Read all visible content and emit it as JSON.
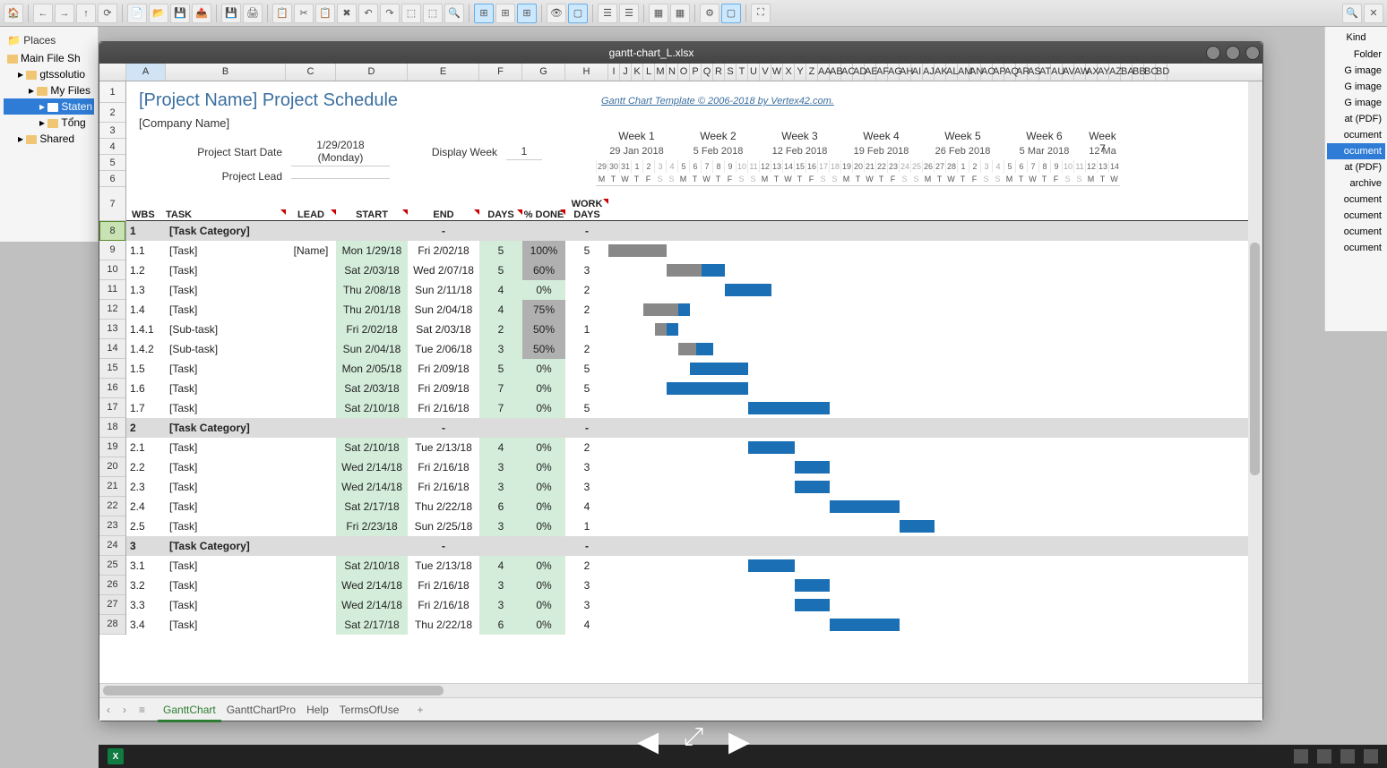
{
  "window_title": "gantt-chart_L.xlsx",
  "sidebar": {
    "places": "Places",
    "items": [
      {
        "label": "Main File Sh",
        "lvl": 1
      },
      {
        "label": "gtssolutio",
        "lvl": 2
      },
      {
        "label": "My Files",
        "lvl": 3
      },
      {
        "label": "Staten",
        "lvl": 4,
        "selected": true
      },
      {
        "label": "Tổng",
        "lvl": 4
      },
      {
        "label": "Shared",
        "lvl": 2
      }
    ]
  },
  "rightpanel": {
    "header": "Kind",
    "items": [
      {
        "t": "Folder"
      },
      {
        "t": "G image"
      },
      {
        "t": "G image"
      },
      {
        "t": "G image"
      },
      {
        "t": "at (PDF)"
      },
      {
        "t": "ocument"
      },
      {
        "t": "ocument",
        "sel": true
      },
      {
        "t": "at (PDF)"
      },
      {
        "t": "archive"
      },
      {
        "t": "ocument"
      },
      {
        "t": "ocument"
      },
      {
        "t": "ocument"
      },
      {
        "t": "ocument"
      }
    ]
  },
  "columns": [
    "A",
    "B",
    "C",
    "D",
    "E",
    "F",
    "G",
    "H",
    "I",
    "J",
    "K",
    "L",
    "M",
    "N",
    "O",
    "P",
    "Q",
    "R",
    "S",
    "T",
    "U",
    "V",
    "W",
    "X",
    "Y",
    "Z",
    "AA",
    "AB",
    "AC",
    "AD",
    "AE",
    "AF",
    "AG",
    "AH",
    "AI",
    "AJ",
    "AK",
    "AL",
    "AM",
    "AN",
    "AO",
    "AP",
    "AQ",
    "AR",
    "AS",
    "AT",
    "AU",
    "AV",
    "AW",
    "AX",
    "AY",
    "AZ",
    "BA",
    "BB",
    "BC",
    "BD"
  ],
  "header": {
    "title": "[Project Name] Project Schedule",
    "company": "[Company Name]",
    "credit": "Gantt Chart Template © 2006-2018 by Vertex42.com.",
    "start_label": "Project Start Date",
    "start_val": "1/29/2018 (Monday)",
    "display_label": "Display Week",
    "display_val": "1",
    "lead_label": "Project Lead"
  },
  "tblhdr": {
    "wbs": "WBS",
    "task": "TASK",
    "lead": "LEAD",
    "start": "START",
    "end": "END",
    "days": "DAYS",
    "done": "% DONE",
    "work": "WORK DAYS"
  },
  "weeks": [
    {
      "title": "Week 1",
      "date": "29 Jan 2018",
      "days": [
        "29",
        "30",
        "31",
        "1",
        "2",
        "3",
        "4"
      ]
    },
    {
      "title": "Week 2",
      "date": "5 Feb 2018",
      "days": [
        "5",
        "6",
        "7",
        "8",
        "9",
        "10",
        "11"
      ]
    },
    {
      "title": "Week 3",
      "date": "12 Feb 2018",
      "days": [
        "12",
        "13",
        "14",
        "15",
        "16",
        "17",
        "18"
      ]
    },
    {
      "title": "Week 4",
      "date": "19 Feb 2018",
      "days": [
        "19",
        "20",
        "21",
        "22",
        "23",
        "24",
        "25"
      ]
    },
    {
      "title": "Week 5",
      "date": "26 Feb 2018",
      "days": [
        "26",
        "27",
        "28",
        "1",
        "2",
        "3",
        "4"
      ]
    },
    {
      "title": "Week 6",
      "date": "5 Mar 2018",
      "days": [
        "5",
        "6",
        "7",
        "8",
        "9",
        "10",
        "11"
      ]
    },
    {
      "title": "Week 7",
      "date": "12 Ma",
      "days": [
        "12",
        "13",
        "14"
      ]
    }
  ],
  "dow": [
    "M",
    "T",
    "W",
    "T",
    "F",
    "S",
    "S"
  ],
  "rows": [
    {
      "n": 8,
      "cat": true,
      "wbs": "1",
      "task": "[Task Category]",
      "end": "-",
      "work": "-"
    },
    {
      "n": 9,
      "wbs": "1.1",
      "task": "[Task]",
      "lead": "[Name]",
      "start": "Mon 1/29/18",
      "end": "Fri 2/02/18",
      "days": "5",
      "done": "100%",
      "dcls": "pgrey",
      "work": "5",
      "bar": {
        "off": 0,
        "len": 5,
        "prog": 100
      }
    },
    {
      "n": 10,
      "wbs": "1.2",
      "task": "[Task]",
      "start": "Sat 2/03/18",
      "end": "Wed 2/07/18",
      "days": "5",
      "done": "60%",
      "dcls": "pgrey",
      "work": "3",
      "bar": {
        "off": 5,
        "len": 5,
        "prog": 60
      }
    },
    {
      "n": 11,
      "wbs": "1.3",
      "task": "[Task]",
      "start": "Thu 2/08/18",
      "end": "Sun 2/11/18",
      "days": "4",
      "done": "0%",
      "dcls": "pgreen",
      "work": "2",
      "bar": {
        "off": 10,
        "len": 4,
        "prog": 0
      }
    },
    {
      "n": 12,
      "wbs": "1.4",
      "task": "[Task]",
      "start": "Thu 2/01/18",
      "end": "Sun 2/04/18",
      "days": "4",
      "done": "75%",
      "dcls": "pgrey",
      "work": "2",
      "bar": {
        "off": 3,
        "len": 4,
        "prog": 75
      }
    },
    {
      "n": 13,
      "wbs": "1.4.1",
      "task": "[Sub-task]",
      "start": "Fri 2/02/18",
      "end": "Sat 2/03/18",
      "days": "2",
      "done": "50%",
      "dcls": "pgrey",
      "work": "1",
      "bar": {
        "off": 4,
        "len": 2,
        "prog": 50
      }
    },
    {
      "n": 14,
      "wbs": "1.4.2",
      "task": "[Sub-task]",
      "start": "Sun 2/04/18",
      "end": "Tue 2/06/18",
      "days": "3",
      "done": "50%",
      "dcls": "pgrey",
      "work": "2",
      "bar": {
        "off": 6,
        "len": 3,
        "prog": 50
      }
    },
    {
      "n": 15,
      "wbs": "1.5",
      "task": "[Task]",
      "start": "Mon 2/05/18",
      "end": "Fri 2/09/18",
      "days": "5",
      "done": "0%",
      "dcls": "pgreen",
      "work": "5",
      "bar": {
        "off": 7,
        "len": 5,
        "prog": 0
      }
    },
    {
      "n": 16,
      "wbs": "1.6",
      "task": "[Task]",
      "start": "Sat 2/03/18",
      "end": "Fri 2/09/18",
      "days": "7",
      "done": "0%",
      "dcls": "pgreen",
      "work": "5",
      "bar": {
        "off": 5,
        "len": 7,
        "prog": 0
      }
    },
    {
      "n": 17,
      "wbs": "1.7",
      "task": "[Task]",
      "start": "Sat 2/10/18",
      "end": "Fri 2/16/18",
      "days": "7",
      "done": "0%",
      "dcls": "pgreen",
      "work": "5",
      "bar": {
        "off": 12,
        "len": 7,
        "prog": 0
      }
    },
    {
      "n": 18,
      "cat": true,
      "wbs": "2",
      "task": "[Task Category]",
      "end": "-",
      "work": "-"
    },
    {
      "n": 19,
      "wbs": "2.1",
      "task": "[Task]",
      "start": "Sat 2/10/18",
      "end": "Tue 2/13/18",
      "days": "4",
      "done": "0%",
      "dcls": "pgreen",
      "work": "2",
      "bar": {
        "off": 12,
        "len": 4,
        "prog": 0
      }
    },
    {
      "n": 20,
      "wbs": "2.2",
      "task": "[Task]",
      "start": "Wed 2/14/18",
      "end": "Fri 2/16/18",
      "days": "3",
      "done": "0%",
      "dcls": "pgreen",
      "work": "3",
      "bar": {
        "off": 16,
        "len": 3,
        "prog": 0
      }
    },
    {
      "n": 21,
      "wbs": "2.3",
      "task": "[Task]",
      "start": "Wed 2/14/18",
      "end": "Fri 2/16/18",
      "days": "3",
      "done": "0%",
      "dcls": "pgreen",
      "work": "3",
      "bar": {
        "off": 16,
        "len": 3,
        "prog": 0
      }
    },
    {
      "n": 22,
      "wbs": "2.4",
      "task": "[Task]",
      "start": "Sat 2/17/18",
      "end": "Thu 2/22/18",
      "days": "6",
      "done": "0%",
      "dcls": "pgreen",
      "work": "4",
      "bar": {
        "off": 19,
        "len": 6,
        "prog": 0
      }
    },
    {
      "n": 23,
      "wbs": "2.5",
      "task": "[Task]",
      "start": "Fri 2/23/18",
      "end": "Sun 2/25/18",
      "days": "3",
      "done": "0%",
      "dcls": "pgreen",
      "work": "1",
      "bar": {
        "off": 25,
        "len": 3,
        "prog": 0
      }
    },
    {
      "n": 24,
      "cat": true,
      "wbs": "3",
      "task": "[Task Category]",
      "end": "-",
      "work": "-"
    },
    {
      "n": 25,
      "wbs": "3.1",
      "task": "[Task]",
      "start": "Sat 2/10/18",
      "end": "Tue 2/13/18",
      "days": "4",
      "done": "0%",
      "dcls": "pgreen",
      "work": "2",
      "bar": {
        "off": 12,
        "len": 4,
        "prog": 0
      }
    },
    {
      "n": 26,
      "wbs": "3.2",
      "task": "[Task]",
      "start": "Wed 2/14/18",
      "end": "Fri 2/16/18",
      "days": "3",
      "done": "0%",
      "dcls": "pgreen",
      "work": "3",
      "bar": {
        "off": 16,
        "len": 3,
        "prog": 0
      }
    },
    {
      "n": 27,
      "wbs": "3.3",
      "task": "[Task]",
      "start": "Wed 2/14/18",
      "end": "Fri 2/16/18",
      "days": "3",
      "done": "0%",
      "dcls": "pgreen",
      "work": "3",
      "bar": {
        "off": 16,
        "len": 3,
        "prog": 0
      }
    },
    {
      "n": 28,
      "wbs": "3.4",
      "task": "[Task]",
      "start": "Sat 2/17/18",
      "end": "Thu 2/22/18",
      "days": "6",
      "done": "0%",
      "dcls": "pgreen",
      "work": "4",
      "bar": {
        "off": 19,
        "len": 6,
        "prog": 0
      }
    }
  ],
  "tabs": [
    "GanttChart",
    "GanttChartPro",
    "Help",
    "TermsOfUse"
  ],
  "tab_active": 0
}
